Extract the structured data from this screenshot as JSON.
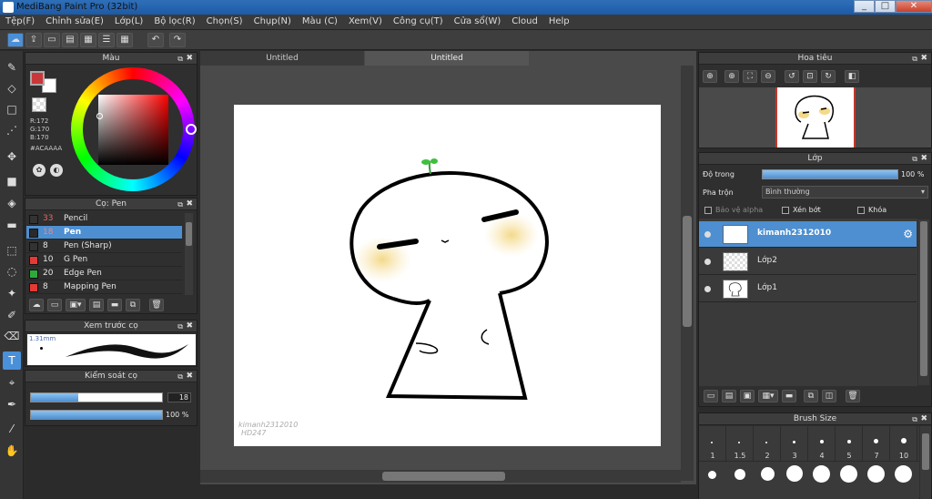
{
  "window": {
    "title": "MediBang Paint Pro (32bit)",
    "min": "_",
    "max": "□",
    "close": "✕"
  },
  "menu": [
    "Tệp(F)",
    "Chỉnh sửa(E)",
    "Lớp(L)",
    "Bộ lọc(R)",
    "Chọn(S)",
    "Chụp(N)",
    "Màu (C)",
    "Xem(V)",
    "Công cụ(T)",
    "Cửa sổ(W)",
    "Cloud",
    "Help"
  ],
  "color_panel": {
    "title": "Màu",
    "r": "R:172",
    "g": "G:170",
    "b": "B:170",
    "hex": "#ACAAAA",
    "foreground": "#c8383a",
    "background": "#ffffff"
  },
  "brush_panel": {
    "title": "Cọ: Pen",
    "items": [
      {
        "size": "33",
        "name": "Pencil",
        "color": "#333333"
      },
      {
        "size": "18",
        "name": "Pen",
        "color": "#2a2a2a"
      },
      {
        "size": "8",
        "name": "Pen (Sharp)",
        "color": "#333333"
      },
      {
        "size": "10",
        "name": "G Pen",
        "color": "#e53935"
      },
      {
        "size": "20",
        "name": "Edge Pen",
        "color": "#2eaa3a"
      },
      {
        "size": "8",
        "name": "Mapping Pen",
        "color": "#e53935"
      }
    ]
  },
  "brush_preview": {
    "title": "Xem trước cọ",
    "size_label": "1.31mm"
  },
  "brush_control": {
    "title": "Kiểm soát cọ",
    "size_value": "18",
    "opacity_value": "100 %",
    "size_fraction": 0.36,
    "opacity_fraction": 1.0
  },
  "documents": {
    "tabs": [
      "Untitled",
      "Untitled"
    ],
    "watermark_line1": "kimanh2312010",
    "watermark_line2": "HD247"
  },
  "navigator": {
    "title": "Hoa tiêu"
  },
  "layers": {
    "title": "Lớp",
    "opacity_label": "Độ trong",
    "opacity_value": "100 %",
    "blend_label": "Pha trộn",
    "blend_value": "Bình thường",
    "protect_alpha": "Bảo vệ alpha",
    "clipping": "Xén bớt",
    "lock": "Khóa",
    "items": [
      {
        "name": "kimanh2312010",
        "selected": true
      },
      {
        "name": "Lớp2",
        "selected": false
      },
      {
        "name": "Lớp1",
        "selected": false
      }
    ]
  },
  "brush_size": {
    "title": "Brush Size",
    "sizes": [
      "1",
      "1.5",
      "2",
      "3",
      "4",
      "5",
      "7",
      "10"
    ]
  }
}
